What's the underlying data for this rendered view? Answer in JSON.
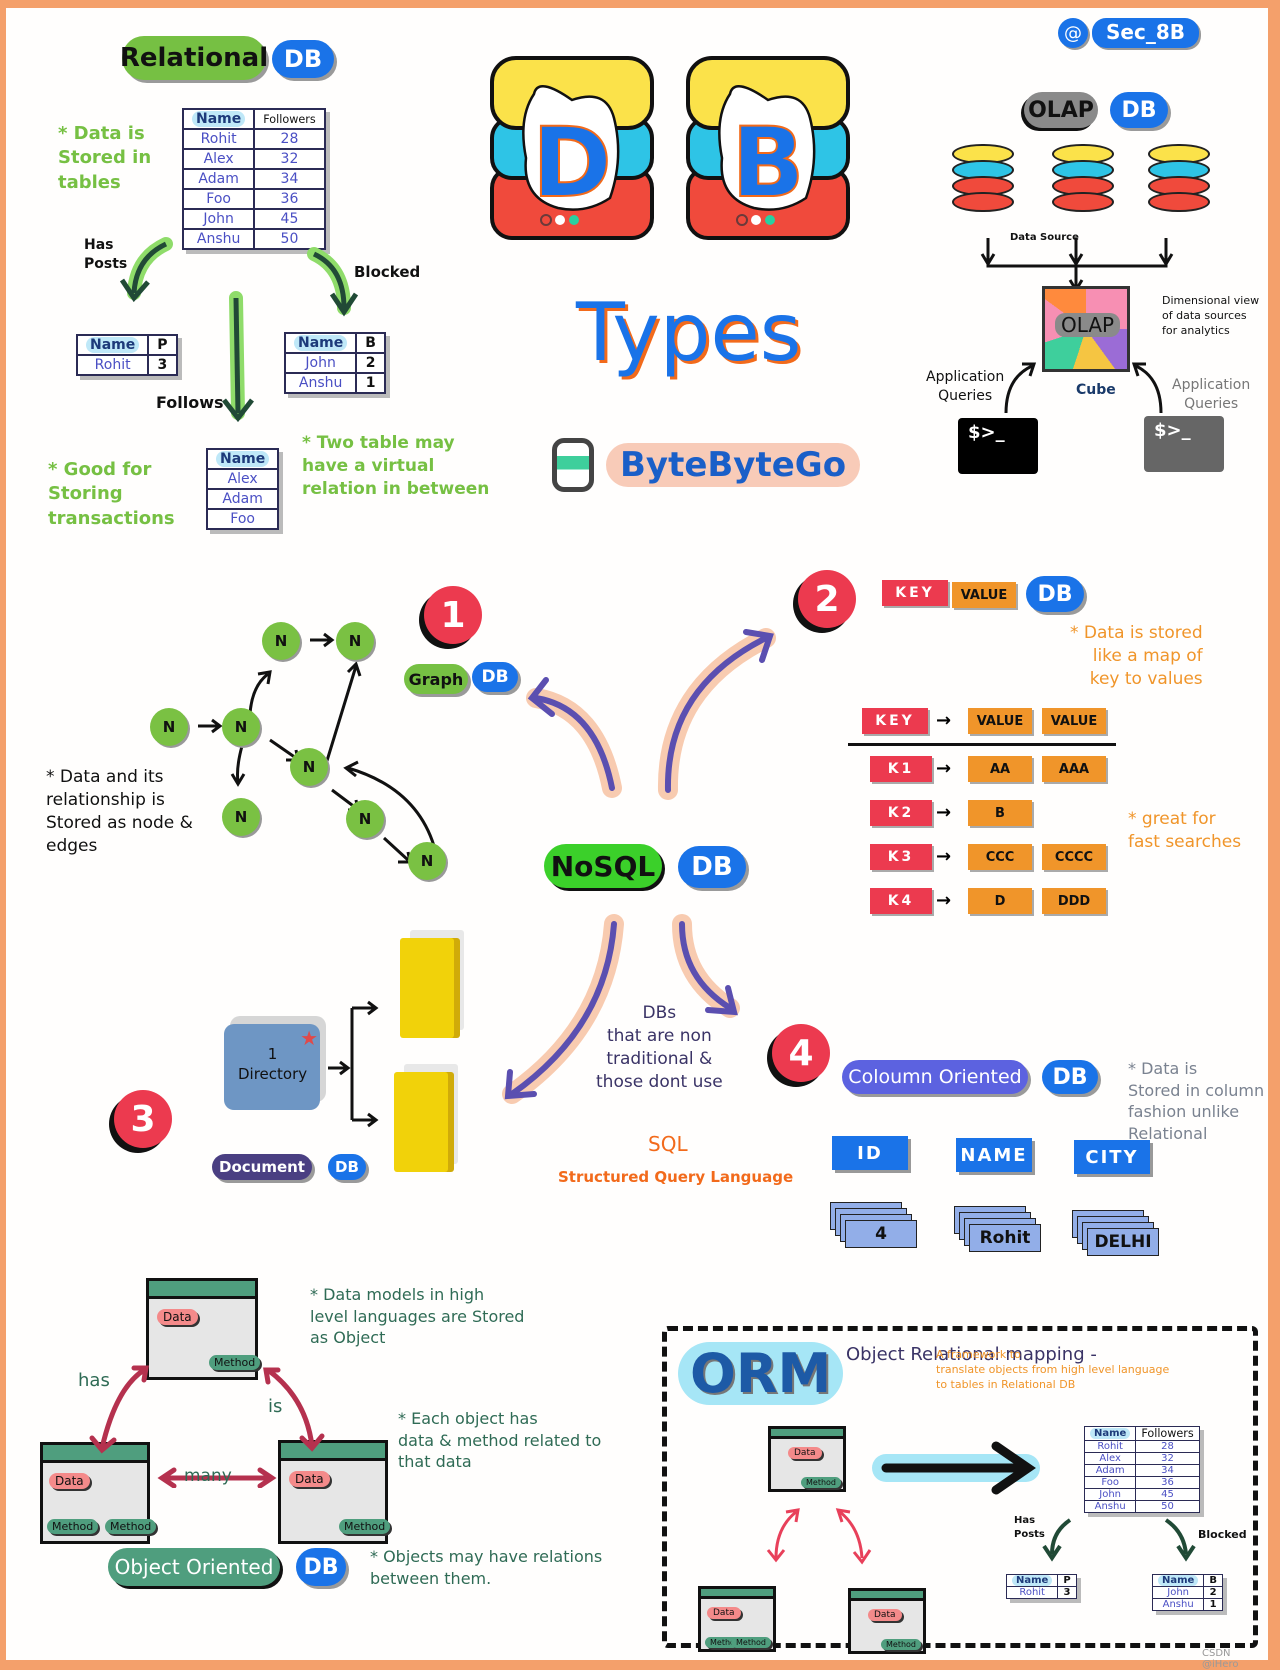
{
  "title": {
    "letters": [
      "D",
      "B"
    ],
    "subtitle": "Types",
    "brand": "ByteByteGo"
  },
  "handle": {
    "icon": "at-icon",
    "text": "Sec_8B"
  },
  "watermark": "CSDN @iHero",
  "db_label": "DB",
  "relational": {
    "label": "Relational",
    "notes": [
      "* Data is\nStored in\ntables",
      "* Good for\nStoring\ntransactions",
      "* Two table may\nhave a virtual\nrelation in between"
    ],
    "main_table": {
      "headers": [
        "Name",
        "Followers"
      ],
      "rows": [
        [
          "Rohit",
          "28"
        ],
        [
          "Alex",
          "32"
        ],
        [
          "Adam",
          "34"
        ],
        [
          "Foo",
          "36"
        ],
        [
          "John",
          "45"
        ],
        [
          "Anshu",
          "50"
        ]
      ]
    },
    "has_posts": {
      "label": "Has\nPosts",
      "headers": [
        "Name",
        "P"
      ],
      "rows": [
        [
          "Rohit",
          "3"
        ]
      ]
    },
    "blocked": {
      "label": "Blocked",
      "headers": [
        "Name",
        "B"
      ],
      "rows": [
        [
          "John",
          "2"
        ],
        [
          "Anshu",
          "1"
        ]
      ]
    },
    "follows": {
      "label": "Follows",
      "headers": [
        "Name"
      ],
      "rows": [
        [
          "Alex"
        ],
        [
          "Adam"
        ],
        [
          "Foo"
        ]
      ]
    }
  },
  "olap": {
    "label": "OLAP",
    "data_source": "Data Source",
    "cube_label": "OLAP",
    "cube_caption": "Cube",
    "note": "Dimensional view\nof data sources\nfor analytics",
    "query_left": "Application\nQueries",
    "query_right": "Application\nQueries",
    "prompt": "$>_"
  },
  "nosql": {
    "label": "NoSQL",
    "desc": "DBs\nthat are non\ntraditional &\nthose dont use",
    "sql": "SQL",
    "sql_full": "Structured Query Language"
  },
  "graph": {
    "number": "1",
    "label": "Graph",
    "node": "N",
    "note": "* Data and its\nrelationship is\nStored as node &\nedges"
  },
  "key_value": {
    "number": "2",
    "key_label": "KEY",
    "value_label": "VALUE",
    "note1": "* Data is stored\nlike a map of\nkey to values",
    "note2": "* great for\nfast searches",
    "schema": {
      "key": "KEY",
      "values": [
        "VALUE",
        "VALUE"
      ]
    },
    "rows": [
      {
        "key": "K1",
        "values": [
          "AA",
          "AAA"
        ]
      },
      {
        "key": "K2",
        "values": [
          "B"
        ]
      },
      {
        "key": "K3",
        "values": [
          "CCC",
          "CCCC"
        ]
      },
      {
        "key": "K4",
        "values": [
          "D",
          "DDD"
        ]
      }
    ]
  },
  "document": {
    "number": "3",
    "label": "Document",
    "directory": "1\nDirectory"
  },
  "column": {
    "number": "4",
    "label": "Coloumn Oriented",
    "note": "* Data is\nStored in column\nfashion unlike\nRelational\nDB",
    "headers": [
      "ID",
      "NAME",
      "CITY"
    ],
    "values": [
      "4",
      "Rohit",
      "DELHI"
    ]
  },
  "object": {
    "label": "Object Oriented",
    "data_chip": "Data",
    "method_chip": "Method",
    "relations": [
      "has",
      "is",
      "many"
    ],
    "notes": [
      "* Data models in high\nlevel languages are Stored\nas Object",
      "* Each object has\ndata & method related to\nthat data",
      "* Objects may have relations\nbetween them."
    ]
  },
  "orm": {
    "label": "ORM",
    "title": "Object Relational mapping -",
    "desc": "A framework to\ntranslate objects from high level language\nto tables in Relational DB"
  }
}
